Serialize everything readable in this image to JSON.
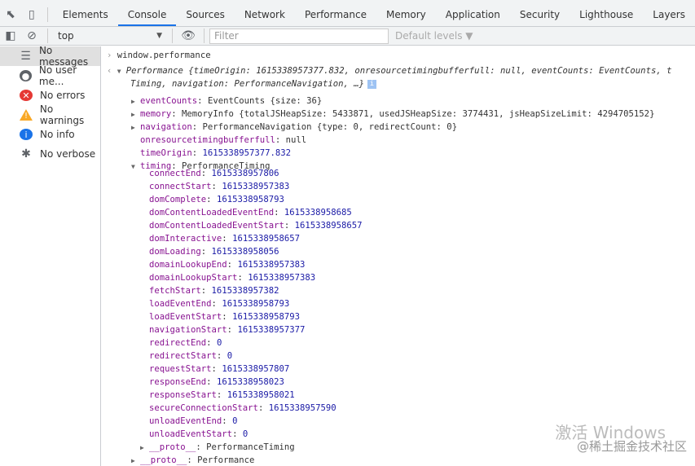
{
  "tabs": [
    "Elements",
    "Console",
    "Sources",
    "Network",
    "Performance",
    "Memory",
    "Application",
    "Security",
    "Lighthouse",
    "Layers"
  ],
  "active_tab": "Console",
  "toolbar": {
    "context": "top",
    "filter_placeholder": "Filter",
    "levels": "Default levels ▼"
  },
  "sidebar": [
    {
      "label": "No messages",
      "icon": "list-icon",
      "color": "#5f6368"
    },
    {
      "label": "No user me...",
      "icon": "user-icon",
      "color": "#5f6368"
    },
    {
      "label": "No errors",
      "icon": "error-icon",
      "color": "#e53935"
    },
    {
      "label": "No warnings",
      "icon": "warning-icon",
      "color": "#f9a825"
    },
    {
      "label": "No info",
      "icon": "info-icon",
      "color": "#1a73e8"
    },
    {
      "label": "No verbose",
      "icon": "bug-icon",
      "color": "#5f6368"
    }
  ],
  "console": {
    "input": "window.performance",
    "summary1": "Performance {timeOrigin: 1615338957377.832, onresourcetimingbufferfull: null, eventCounts: EventCounts, t",
    "summary2": "Timing, navigation: PerformanceNavigation, …}",
    "props": [
      {
        "key": "eventCounts",
        "value": "EventCounts {size: 36}",
        "expandable": true
      },
      {
        "key": "memory",
        "value": "MemoryInfo {totalJSHeapSize: 5433871, usedJSHeapSize: 3774431, jsHeapSizeLimit: 4294705152}",
        "expandable": true
      },
      {
        "key": "navigation",
        "value": "PerformanceNavigation {type: 0, redirectCount: 0}",
        "expandable": true
      },
      {
        "key": "onresourcetimingbufferfull",
        "value": "null",
        "expandable": false
      },
      {
        "key": "timeOrigin",
        "value": "1615338957377.832",
        "expandable": false
      },
      {
        "key": "timing",
        "value": "PerformanceTiming",
        "expandable": true,
        "expanded": true
      }
    ],
    "timing": [
      {
        "key": "connectEnd",
        "value": "1615338957806"
      },
      {
        "key": "connectStart",
        "value": "1615338957383"
      },
      {
        "key": "domComplete",
        "value": "1615338958793"
      },
      {
        "key": "domContentLoadedEventEnd",
        "value": "1615338958685"
      },
      {
        "key": "domContentLoadedEventStart",
        "value": "1615338958657"
      },
      {
        "key": "domInteractive",
        "value": "1615338958657"
      },
      {
        "key": "domLoading",
        "value": "1615338958056"
      },
      {
        "key": "domainLookupEnd",
        "value": "1615338957383"
      },
      {
        "key": "domainLookupStart",
        "value": "1615338957383"
      },
      {
        "key": "fetchStart",
        "value": "1615338957382"
      },
      {
        "key": "loadEventEnd",
        "value": "1615338958793"
      },
      {
        "key": "loadEventStart",
        "value": "1615338958793"
      },
      {
        "key": "navigationStart",
        "value": "1615338957377"
      },
      {
        "key": "redirectEnd",
        "value": "0"
      },
      {
        "key": "redirectStart",
        "value": "0"
      },
      {
        "key": "requestStart",
        "value": "1615338957807"
      },
      {
        "key": "responseEnd",
        "value": "1615338958023"
      },
      {
        "key": "responseStart",
        "value": "1615338958021"
      },
      {
        "key": "secureConnectionStart",
        "value": "1615338957590"
      },
      {
        "key": "unloadEventEnd",
        "value": "0"
      },
      {
        "key": "unloadEventStart",
        "value": "0"
      }
    ],
    "timing_proto": {
      "key": "__proto__",
      "value": "PerformanceTiming"
    },
    "proto": {
      "key": "__proto__",
      "value": "Performance"
    }
  },
  "watermark": {
    "line1": "激活 Windows",
    "line2": "@稀土掘金技术社区"
  }
}
